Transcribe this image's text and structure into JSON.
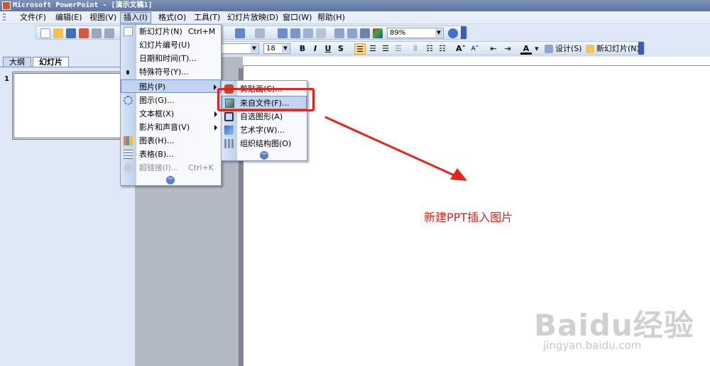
{
  "window": {
    "title": "Microsoft PowerPoint - [演示文稿1]"
  },
  "menubar": [
    {
      "label": "文件(F)"
    },
    {
      "label": "编辑(E)"
    },
    {
      "label": "视图(V)"
    },
    {
      "label": "插入(I)"
    },
    {
      "label": "格式(O)"
    },
    {
      "label": "工具(T)"
    },
    {
      "label": "幻灯片放映(D)"
    },
    {
      "label": "窗口(W)"
    },
    {
      "label": "帮助(H)"
    }
  ],
  "toolbar": {
    "zoom": "89%",
    "font_size": "18",
    "bold": "B",
    "italic": "I",
    "underline": "U",
    "shadow": "S",
    "font_color_label": "A",
    "design_label": "设计(S)",
    "new_slide_label": "新幻灯片(N)"
  },
  "left_pane": {
    "tabs": [
      {
        "label": "大纲"
      },
      {
        "label": "幻灯片"
      }
    ],
    "slide_number": "1"
  },
  "insert_menu": {
    "items": [
      {
        "label": "新幻灯片(N)",
        "shortcut": "Ctrl+M"
      },
      {
        "label": "幻灯片编号(U)"
      },
      {
        "label": "日期和时间(T)..."
      },
      {
        "label": "特殊符号(Y)..."
      },
      {
        "label": "图片(P)"
      },
      {
        "label": "图示(G)..."
      },
      {
        "label": "文本框(X)"
      },
      {
        "label": "影片和声音(V)"
      },
      {
        "label": "图表(H)..."
      },
      {
        "label": "表格(B)..."
      },
      {
        "label": "超链接(I)...",
        "shortcut": "Ctrl+K"
      }
    ]
  },
  "picture_submenu": {
    "items": [
      {
        "label": "剪贴画(C)..."
      },
      {
        "label": "来自文件(F)..."
      },
      {
        "label": "自选图形(A)"
      },
      {
        "label": "艺术字(W)..."
      },
      {
        "label": "组织结构图(O)"
      }
    ]
  },
  "annotation": {
    "text": "新建PPT插入图片"
  },
  "watermark": {
    "brand": "Baidu经验",
    "url": "jingyan.baidu.com"
  },
  "colors": {
    "highlight_box": "#e8231a",
    "menu_hover": "#c3d4f1"
  }
}
